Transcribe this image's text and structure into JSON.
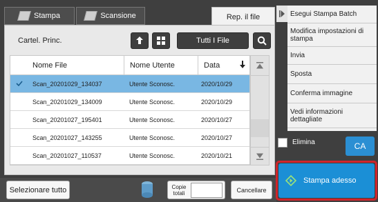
{
  "tabs": [
    {
      "label": "Stampa",
      "icon": "document-icon"
    },
    {
      "label": "Scansione",
      "icon": "document-icon"
    },
    {
      "label": "Rep. il file"
    }
  ],
  "toolbar": {
    "folder_label": "Cartel. Princ.",
    "up_icon": "up-arrow-icon",
    "view_icon": "grid-icon",
    "filter_label": "Tutti I File",
    "search_icon": "search-icon"
  },
  "table": {
    "columns": [
      "Nome File",
      "Nome Utente",
      "Data"
    ],
    "sort_icon": "sort-down-arrow-icon",
    "rows": [
      {
        "name": "Scan_20201029_134037",
        "user": "Utente Sconosc.",
        "date": "2020/10/29",
        "selected": true
      },
      {
        "name": "Scan_20201029_134009",
        "user": "Utente Sconosc.",
        "date": "2020/10/29",
        "selected": false
      },
      {
        "name": "Scan_20201027_195401",
        "user": "Utente Sconosc.",
        "date": "2020/10/27",
        "selected": false
      },
      {
        "name": "Scan_20201027_143255",
        "user": "Utente Sconosc.",
        "date": "2020/10/27",
        "selected": false
      },
      {
        "name": "Scan_20201027_110537",
        "user": "Utente Sconosc.",
        "date": "2020/10/21",
        "selected": false
      }
    ]
  },
  "bottom": {
    "select_all": "Selezionare tutto",
    "copies_label": "Copie totali",
    "copies_value": "",
    "cancel": "Cancellare"
  },
  "right_menu": {
    "items": [
      "Esegui Stampa Batch",
      "Modifica impostazioni di stampa",
      "Invia",
      "Sposta",
      "Conferma immagine",
      "Vedi informazioni dettagliate"
    ],
    "delete_label": "Elimina",
    "ca_label": "CA",
    "print_now": "Stampa adesso"
  },
  "colors": {
    "accent_blue": "#1b8fd6",
    "selection": "#79b7e3",
    "highlight_red": "#d0242b",
    "ca_blue": "#2b8fd3"
  }
}
